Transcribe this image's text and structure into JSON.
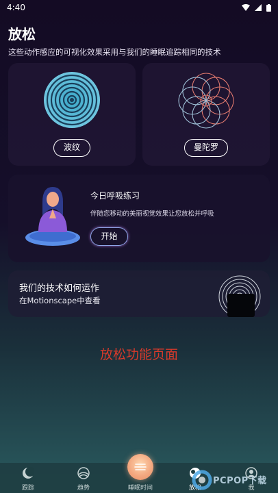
{
  "status_bar": {
    "time": "4:40"
  },
  "page": {
    "title": "放松",
    "subtitle": "这些动作感应的可视化效果采用与我们的睡眠追踪相同的技术"
  },
  "viz_cards": {
    "ripple_label": "波纹",
    "mandala_label": "曼陀罗"
  },
  "breathing": {
    "title": "今日呼吸练习",
    "description": "伴随您移动的美丽视觉效果让您放松并呼吸",
    "start_label": "开始"
  },
  "technology": {
    "title": "我们的技术如何运作",
    "subtitle": "在Motionscape中查看"
  },
  "annotation": "放松功能页面",
  "bottom_nav": {
    "items": [
      {
        "label": "跟踪",
        "icon": "moon-icon"
      },
      {
        "label": "趋势",
        "icon": "trends-icon"
      },
      {
        "label": "睡眠时间",
        "icon": "sunset-icon"
      },
      {
        "label": "放松",
        "icon": "relax-icon",
        "active": true
      },
      {
        "label": "我",
        "icon": "profile-icon"
      }
    ]
  },
  "watermark": {
    "text": "PCPOP下载"
  },
  "colors": {
    "annotation": "#d93a2b",
    "accent_center": "#f3a981",
    "ripple": "#59b7d6",
    "mandala": "#e37a6f"
  }
}
